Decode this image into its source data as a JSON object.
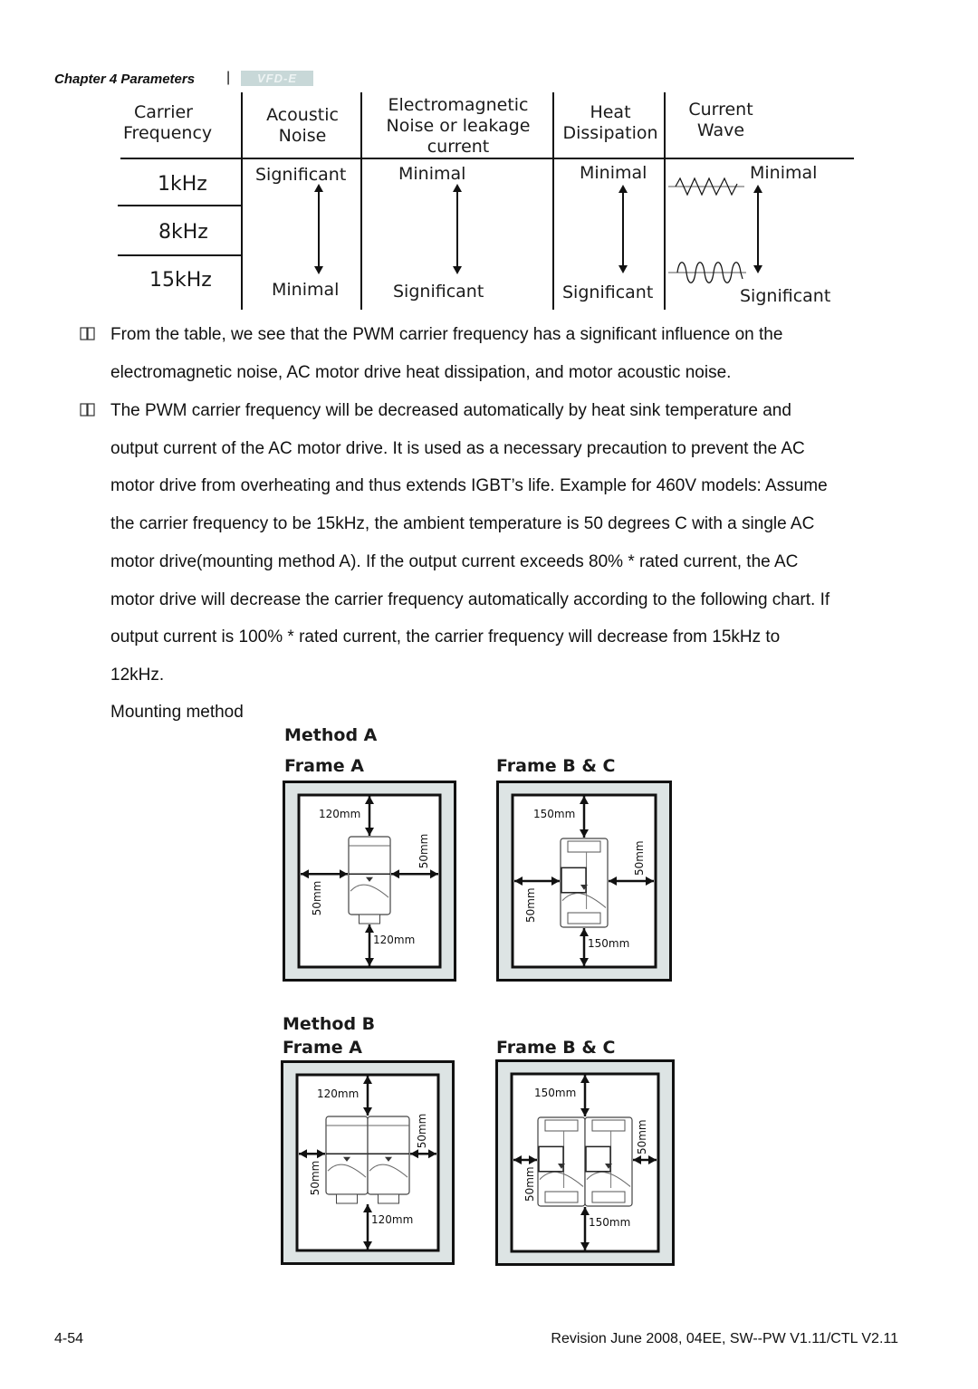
{
  "header": {
    "chapter": "Chapter 4 Parameters",
    "separator": "|",
    "logo_text": "VFD-E"
  },
  "table": {
    "columns": [
      {
        "label_lines": [
          "Carrier",
          "Frequency"
        ]
      },
      {
        "label_lines": [
          "Acoustic",
          "Noise"
        ]
      },
      {
        "label_lines": [
          "Electromagnetic",
          "Noise or leakage",
          "current"
        ]
      },
      {
        "label_lines": [
          "Heat",
          "Dissipation"
        ]
      },
      {
        "label_lines": [
          "Current",
          "Wave"
        ]
      }
    ],
    "frequencies": [
      "1kHz",
      "8kHz",
      "15kHz"
    ],
    "acoustic_noise": {
      "top": "Significant",
      "bottom": "Minimal"
    },
    "em_noise": {
      "top": "Minimal",
      "bottom": "Significant"
    },
    "heat_dissipation": {
      "top": "Minimal",
      "bottom": "Significant"
    },
    "current_wave": {
      "top": "Minimal",
      "bottom": "Significant",
      "top_icon": "triangle-wave-icon",
      "bottom_icon": "sine-wave-icon"
    }
  },
  "paragraphs": [
    {
      "bullet_icon": "book-icon",
      "lines": [
        "From the table, we see that the PWM carrier frequency has a significant influence on the",
        "electromagnetic noise, AC motor drive heat dissipation, and motor acoustic noise."
      ]
    },
    {
      "bullet_icon": "book-icon",
      "lines": [
        "The PWM carrier frequency will be decreased automatically by heat sink temperature and",
        "output current of the AC motor drive. It is used as a necessary precaution to prevent the AC",
        "motor drive from overheating and thus extends IGBT’s life. Example for 460V models: Assume",
        "the carrier frequency to be 15kHz, the ambient temperature is 50 degrees C with a single AC",
        "motor drive(mounting method A). If the output current exceeds 80% * rated current, the AC",
        "motor drive will decrease the carrier frequency automatically according to the following chart. If",
        "output current is 100% * rated current, the carrier frequency will decrease from 15kHz to",
        "12kHz."
      ]
    }
  ],
  "mounting": {
    "title": "Mounting method",
    "methods": [
      {
        "label": "Method A",
        "frames": [
          {
            "label": "Frame A",
            "top": "120mm",
            "bottom": "120mm",
            "left": "50mm",
            "right": "50mm",
            "units": 1
          },
          {
            "label": "Frame B & C",
            "top": "150mm",
            "bottom": "150mm",
            "left": "50mm",
            "right": "50mm",
            "units": 1
          }
        ]
      },
      {
        "label": "Method B",
        "frames": [
          {
            "label": "Frame A",
            "top": "120mm",
            "bottom": "120mm",
            "left": "50mm",
            "right": "50mm",
            "units": 2
          },
          {
            "label": "Frame B & C",
            "top": "150mm",
            "bottom": "150mm",
            "left": "50mm",
            "right": "50mm",
            "units": 2
          }
        ]
      }
    ]
  },
  "footer": {
    "page_number": "4-54",
    "revision": "Revision June 2008, 04EE, SW--PW V1.11/CTL V2.11"
  }
}
